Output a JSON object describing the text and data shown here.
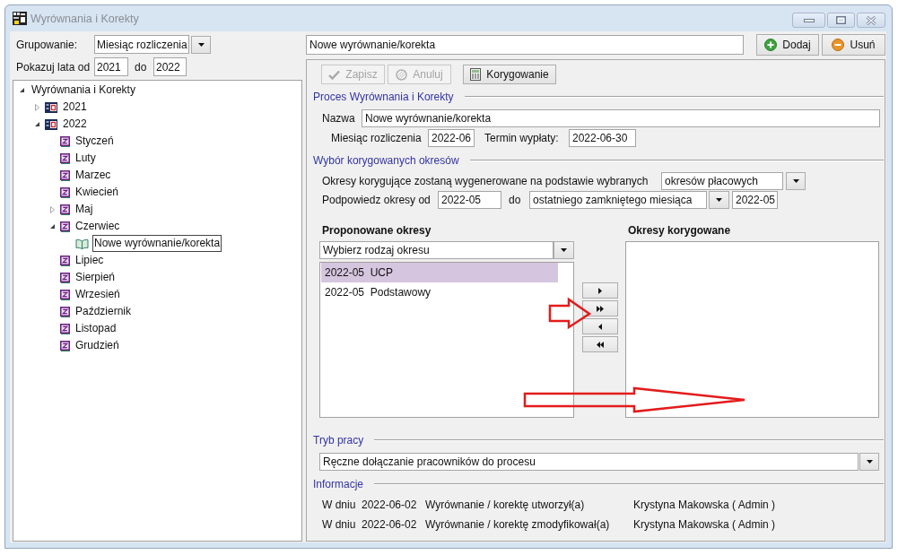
{
  "window": {
    "title": "Wyrównania i Korekty"
  },
  "filters": {
    "grouping_label": "Grupowanie:",
    "grouping_value": "Miesiąc rozliczenia",
    "years_label": "Pokazuj lata od",
    "year_from": "2021",
    "years_to_label": "do",
    "year_to": "2022"
  },
  "tree": [
    {
      "label": "Wyrównania i Korekty",
      "expanded": true,
      "selected": false,
      "children": [
        {
          "label": "2021",
          "kind": "year",
          "expanded": false,
          "selected": false
        },
        {
          "label": "2022",
          "kind": "year",
          "expanded": true,
          "selected": false,
          "children": [
            {
              "label": "Styczeń",
              "kind": "month",
              "selected": false
            },
            {
              "label": "Luty",
              "kind": "month",
              "selected": false
            },
            {
              "label": "Marzec",
              "kind": "month",
              "selected": false
            },
            {
              "label": "Kwiecień",
              "kind": "month",
              "selected": false
            },
            {
              "label": "Maj",
              "kind": "month",
              "expanded": false,
              "selected": false
            },
            {
              "label": "Czerwiec",
              "kind": "month",
              "expanded": true,
              "selected": false,
              "children": [
                {
                  "label": "Nowe wyrównanie/korekta",
                  "kind": "document",
                  "selected": true
                }
              ]
            },
            {
              "label": "Lipiec",
              "kind": "month",
              "selected": false
            },
            {
              "label": "Sierpień",
              "kind": "month",
              "selected": false
            },
            {
              "label": "Wrzesień",
              "kind": "month",
              "selected": false
            },
            {
              "label": "Październik",
              "kind": "month",
              "selected": false
            },
            {
              "label": "Listopad",
              "kind": "month",
              "selected": false
            },
            {
              "label": "Grudzień",
              "kind": "month",
              "selected": false
            }
          ]
        }
      ]
    }
  ],
  "record": {
    "name": "Nowe wyrównanie/korekta"
  },
  "actions": [
    {
      "label": "Dodaj",
      "kind": "add"
    },
    {
      "label": "Usuń",
      "kind": "remove"
    }
  ],
  "toolbar": [
    {
      "label": "Zapisz",
      "kind": "save",
      "disabled": true
    },
    {
      "label": "Anuluj",
      "kind": "cancel",
      "disabled": true
    },
    {
      "label": "Korygowanie",
      "kind": "calculate",
      "disabled": false
    }
  ],
  "process": {
    "title": "Proces Wyrównania i Korekty",
    "name_label": "Nazwa",
    "name": "Nowe wyrównanie/korekta",
    "month_label": "Miesiąc rozliczenia",
    "month": "2022-06",
    "payday_label": "Termin wypłaty:",
    "payday": "2022-06-30"
  },
  "period_selection": {
    "title": "Wybór korygowanych okresów",
    "basis_label": "Okresy korygujące zostaną wygenerowane na podstawie wybranych",
    "basis": "okresów płacowych",
    "hint_label": "Podpowiedz okresy od",
    "hint_from": "2022-05",
    "hint_to_label": "do",
    "hint_to_mode": "ostatniego zamkniętego miesiąca",
    "hint_to": "2022-05"
  },
  "proposed": {
    "title": "Proponowane okresy",
    "period_type": "Wybierz rodzaj okresu",
    "items": [
      {
        "label": "2022-05  UCP",
        "selected": true
      },
      {
        "label": "2022-05  Podstawowy",
        "selected": false
      }
    ]
  },
  "transfer_buttons": [
    {
      "kind": "add_one"
    },
    {
      "kind": "add_all"
    },
    {
      "kind": "remove_one"
    },
    {
      "kind": "remove_all"
    }
  ],
  "corrected": {
    "title": "Okresy korygowane"
  },
  "work_mode": {
    "title": "Tryb pracy",
    "value": "Ręczne dołączanie pracowników do procesu"
  },
  "info": {
    "title": "Informacje",
    "rows": [
      {
        "prefix": "W dniu",
        "date": "2022-06-02",
        "action": "Wyrównanie / korektę utworzył(a)",
        "user": "Krystyna Makowska ( Admin )"
      },
      {
        "prefix": "W dniu",
        "date": "2022-06-02",
        "action": "Wyrównanie / korektę zmodyfikował(a)",
        "user": "Krystyna Makowska ( Admin )"
      }
    ]
  }
}
